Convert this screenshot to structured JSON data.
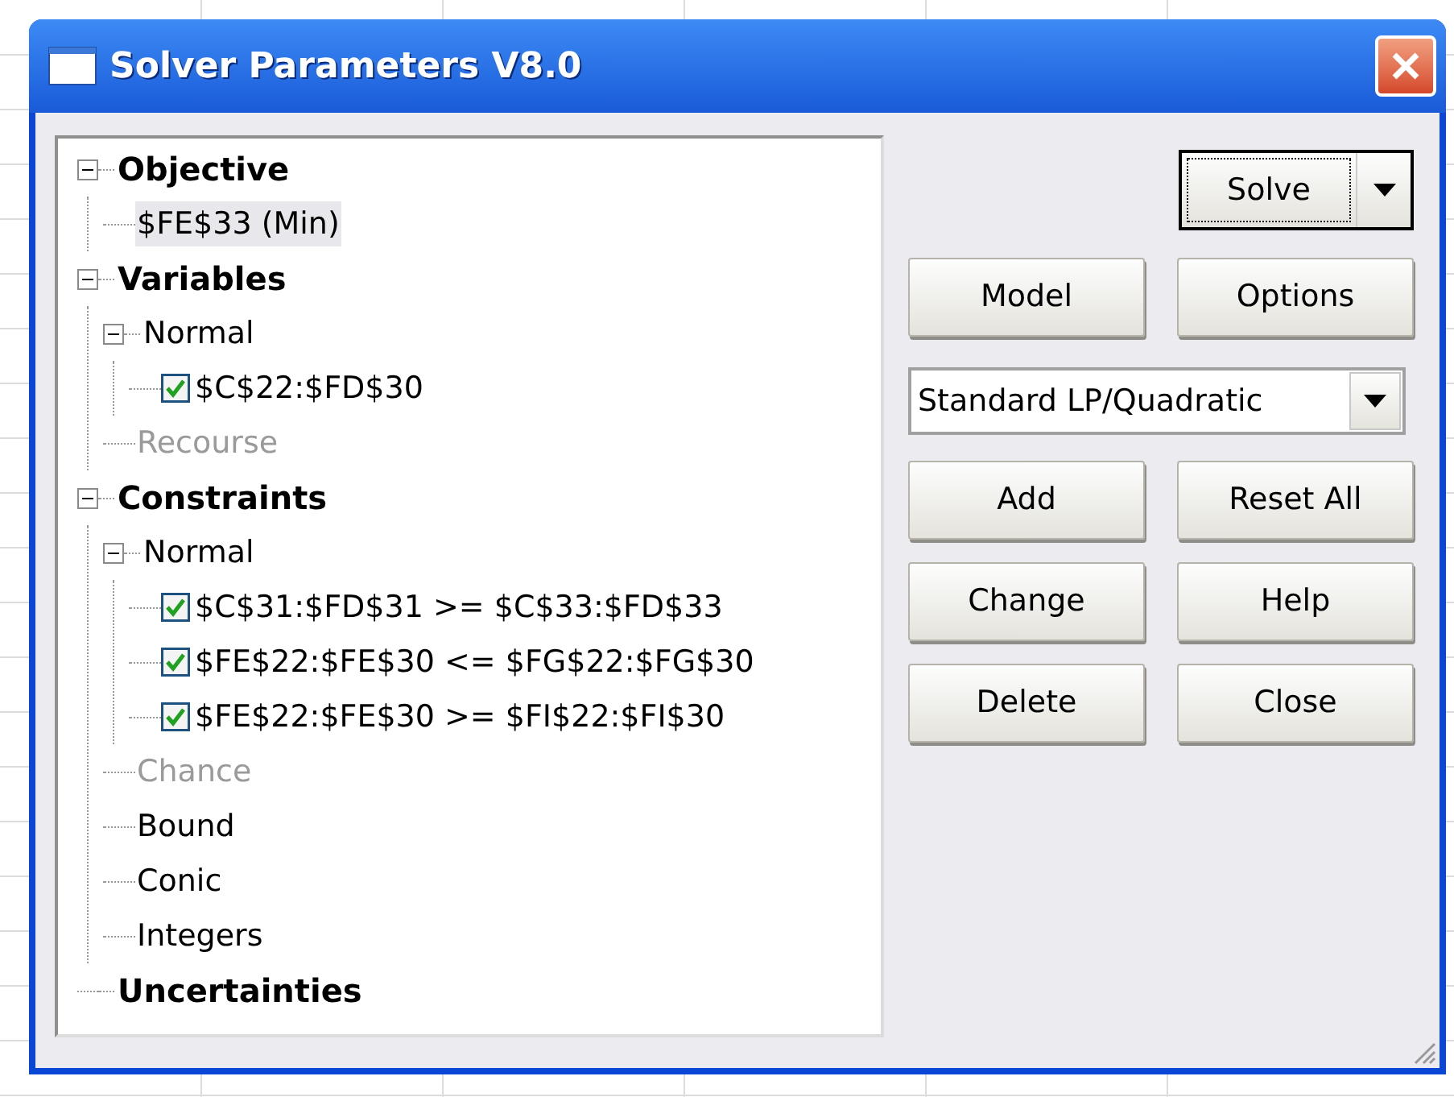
{
  "window": {
    "title": "Solver Parameters V8.0"
  },
  "tree": [
    {
      "label": "Objective",
      "kind": "heading",
      "expanded": true,
      "children": [
        {
          "label": "$FE$33 (Min)",
          "kind": "leaf",
          "selected": true,
          "disabled": false
        }
      ]
    },
    {
      "label": "Variables",
      "kind": "heading",
      "expanded": true,
      "children": [
        {
          "label": "Normal",
          "kind": "group",
          "expanded": true,
          "disabled": false,
          "children": [
            {
              "label": "$C$22:$FD$30",
              "kind": "item",
              "checked": true
            }
          ]
        },
        {
          "label": "Recourse",
          "kind": "leaf",
          "selected": false,
          "disabled": true
        }
      ]
    },
    {
      "label": "Constraints",
      "kind": "heading",
      "expanded": true,
      "children": [
        {
          "label": "Normal",
          "kind": "group",
          "expanded": true,
          "disabled": false,
          "children": [
            {
              "label": "$C$31:$FD$31 >= $C$33:$FD$33",
              "kind": "item",
              "checked": true
            },
            {
              "label": "$FE$22:$FE$30 <= $FG$22:$FG$30",
              "kind": "item",
              "checked": true
            },
            {
              "label": "$FE$22:$FE$30 >= $FI$22:$FI$30",
              "kind": "item",
              "checked": true
            }
          ]
        },
        {
          "label": "Chance",
          "kind": "leaf",
          "selected": false,
          "disabled": true
        },
        {
          "label": "Bound",
          "kind": "leaf",
          "selected": false,
          "disabled": false
        },
        {
          "label": "Conic",
          "kind": "leaf",
          "selected": false,
          "disabled": false
        },
        {
          "label": "Integers",
          "kind": "leaf",
          "selected": false,
          "disabled": false
        }
      ]
    },
    {
      "label": "Uncertainties",
      "kind": "heading"
    }
  ],
  "solve_button": {
    "label": "Solve"
  },
  "buttons_top": [
    "Model",
    "Options"
  ],
  "engine_select": {
    "value": "Standard LP/Quadratic"
  },
  "buttons": [
    [
      "Add",
      "Reset All"
    ],
    [
      "Change",
      "Help"
    ],
    [
      "Delete",
      "Close"
    ]
  ]
}
